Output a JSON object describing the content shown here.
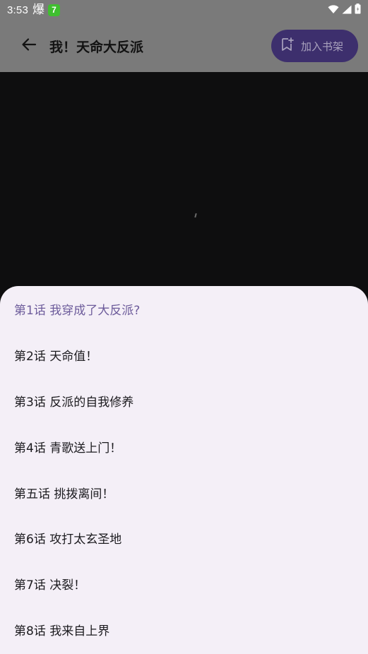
{
  "status_bar": {
    "time": "3:53",
    "app_icon_glyph": "爆",
    "badge_text": "7",
    "icons": [
      "wifi-icon",
      "signal-icon",
      "battery-icon"
    ]
  },
  "app_bar": {
    "title": "我！天命大反派",
    "back_icon": "arrow-left-icon",
    "add_shelf_label": "加入书架",
    "add_shelf_icon": "bookmark-add-icon"
  },
  "colors": {
    "scrim": "#7a7a7a",
    "accent_button": "#3d2f6d",
    "sheet_background": "#f4eff7",
    "current_chapter": "#6d5c9b",
    "chapter_text": "#1c1b1f"
  },
  "chapters": [
    {
      "label": "第1话 我穿成了大反派?",
      "current": true
    },
    {
      "label": "第2话 天命值！",
      "current": false
    },
    {
      "label": "第3话 反派的自我修养",
      "current": false
    },
    {
      "label": "第4话 青歌送上门！",
      "current": false
    },
    {
      "label": "第五话 挑拨离间！",
      "current": false
    },
    {
      "label": "第6话 攻打太玄圣地",
      "current": false
    },
    {
      "label": "第7话 决裂！",
      "current": false
    },
    {
      "label": "第8话 我来自上界",
      "current": false
    }
  ]
}
